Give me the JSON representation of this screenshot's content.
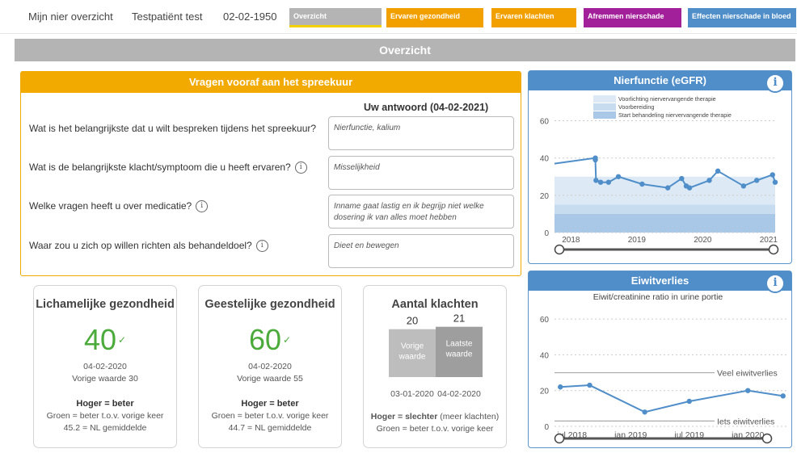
{
  "header": {
    "app_title": "Mijn nier overzicht",
    "patient_name": "Testpatiënt test",
    "birth_date": "02-02-1950",
    "tabs": [
      {
        "label": "Overzicht",
        "color": "#b4b4b4"
      },
      {
        "label": "Ervaren gezondheid",
        "color": "#f2a000"
      },
      {
        "label": "Ervaren klachten",
        "color": "#f2a000"
      },
      {
        "label": "Afremmen nierschade",
        "color": "#a3209b"
      },
      {
        "label": "Effecten nierschade in bloed",
        "color": "#4f8ec9"
      }
    ]
  },
  "banner_title": "Overzicht",
  "questions_panel": {
    "title": "Vragen vooraf aan het spreekuur",
    "answer_header": "Uw antwoord (04-02-2021)",
    "items": [
      {
        "question": "Wat is het belangrijkste dat u wilt bespreken tijdens het spreekuur?",
        "info": false,
        "answer": "Nierfunctie, kalium"
      },
      {
        "question": "Wat is de belangrijkste klacht/symptoom die u heeft ervaren?",
        "info": true,
        "answer": "Misselijkheid"
      },
      {
        "question": "Welke vragen heeft u over medicatie?",
        "info": true,
        "answer": "Inname gaat lastig en ik begrijp niet welke dosering ik van alles moet hebben"
      },
      {
        "question": "Waar zou u zich op willen richten als behandeldoel?",
        "info": true,
        "answer": "Dieet en bewegen"
      }
    ]
  },
  "cards": {
    "physical": {
      "title": "Lichamelijke gezondheid",
      "value": "40",
      "date": "04-02-2020",
      "previous": "Vorige waarde   30",
      "rule": "Hoger = beter",
      "green": "Groen = beter t.o.v. vorige keer",
      "nl_avg": "45.2  = NL gemiddelde"
    },
    "mental": {
      "title": "Geestelijke gezondheid",
      "value": "60",
      "date": "04-02-2020",
      "previous": "Vorige waarde  55",
      "rule": "Hoger = beter",
      "green": "Groen = beter t.o.v. vorige keer",
      "nl_avg": "44.7  = NL gemiddelde"
    },
    "complaints": {
      "title": "Aantal klachten",
      "rule_bold": "Hoger = slechter",
      "rule_rest": " (meer klachten)",
      "green": "Groen = beter t.o.v. vorige keer"
    }
  },
  "chart_data": [
    {
      "type": "bar",
      "title": "Aantal klachten",
      "categories": [
        "Vorige waarde",
        "Laatste waarde"
      ],
      "values": [
        20,
        21
      ],
      "dates": [
        "03-01-2020",
        "04-02-2020"
      ],
      "colors": [
        "#bdbdbd",
        "#9e9e9e"
      ]
    },
    {
      "type": "line",
      "title": "Nierfunctie (eGFR)",
      "x_tick_labels": [
        "2018",
        "2019",
        "2020",
        "2021"
      ],
      "y_ticks": [
        0,
        20,
        40,
        60
      ],
      "ylim": [
        0,
        65
      ],
      "xlim": [
        2017.75,
        2021.1
      ],
      "legend": [
        {
          "label": "Voorlichting niervervangende therapie",
          "color": "#ddeaf6",
          "from": 15,
          "to": 30
        },
        {
          "label": "Voorbereiding",
          "color": "#c8dcf0",
          "from": 10,
          "to": 15
        },
        {
          "label": "Start behandeling niervervangende therapie",
          "color": "#a9c7e6",
          "from": 0,
          "to": 10
        }
      ],
      "series": [
        {
          "x": [
            2017.75,
            2018.37,
            2018.37,
            2018.38,
            2018.45,
            2018.57,
            2018.72,
            2019.08,
            2019.47,
            2019.68,
            2019.75,
            2019.8,
            2020.1,
            2020.23,
            2020.62,
            2020.82,
            2021.06,
            2021.1
          ],
          "y": [
            37,
            40,
            39,
            28,
            27,
            27,
            30,
            26,
            24,
            29,
            25,
            24,
            28,
            33,
            25,
            28,
            31,
            27
          ]
        }
      ],
      "grid": true,
      "grid_line_color": "#4f8ec9"
    },
    {
      "type": "line",
      "title": "Eiwitverlies",
      "subtitle": "Eiwit/creatinine ratio in urine portie",
      "x_tick_labels": [
        "jul 2018",
        "jan 2019",
        "jul 2019",
        "jan 2020"
      ],
      "x_ticks_numeric": [
        2018.5,
        2019.0,
        2019.5,
        2020.0
      ],
      "y_ticks": [
        0,
        20,
        40,
        60
      ],
      "ylim": [
        0,
        65
      ],
      "xlim": [
        2018.35,
        2020.35
      ],
      "reference_lines": [
        {
          "label": "Veel eiwitverlies",
          "y": 30
        },
        {
          "label": "Iets eiwitverlies",
          "y": 3
        }
      ],
      "series": [
        {
          "x": [
            2018.4,
            2018.65,
            2019.12,
            2019.5,
            2020.0,
            2020.3
          ],
          "y": [
            22,
            23,
            8,
            14,
            20,
            17
          ]
        }
      ],
      "grid": true
    }
  ]
}
